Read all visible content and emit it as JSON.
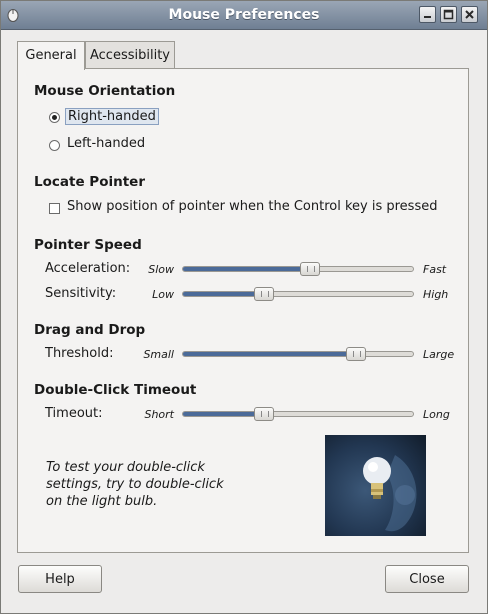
{
  "window": {
    "title": "Mouse Preferences"
  },
  "tabs": [
    {
      "label": "General",
      "active": true
    },
    {
      "label": "Accessibility",
      "active": false
    }
  ],
  "mouse_orientation": {
    "title": "Mouse Orientation",
    "options": [
      {
        "label": "Right-handed",
        "selected": true
      },
      {
        "label": "Left-handed",
        "selected": false
      }
    ]
  },
  "locate_pointer": {
    "title": "Locate Pointer",
    "checkbox_label": "Show position of pointer when the Control key is pressed",
    "checked": false
  },
  "pointer_speed": {
    "title": "Pointer Speed",
    "acceleration": {
      "label": "Acceleration:",
      "low": "Slow",
      "high": "Fast",
      "value": 0.55
    },
    "sensitivity": {
      "label": "Sensitivity:",
      "low": "Low",
      "high": "High",
      "value": 0.35
    }
  },
  "drag_and_drop": {
    "title": "Drag and Drop",
    "threshold": {
      "label": "Threshold:",
      "low": "Small",
      "high": "Large",
      "value": 0.75
    }
  },
  "double_click": {
    "title": "Double-Click Timeout",
    "timeout": {
      "label": "Timeout:",
      "low": "Short",
      "high": "Long",
      "value": 0.35
    },
    "hint": "To test your double-click settings, try to double-click on the light bulb."
  },
  "buttons": {
    "help": "Help",
    "close": "Close"
  },
  "colors": {
    "accent": "#4b6a98",
    "titlebar": "#7f8ea2"
  }
}
